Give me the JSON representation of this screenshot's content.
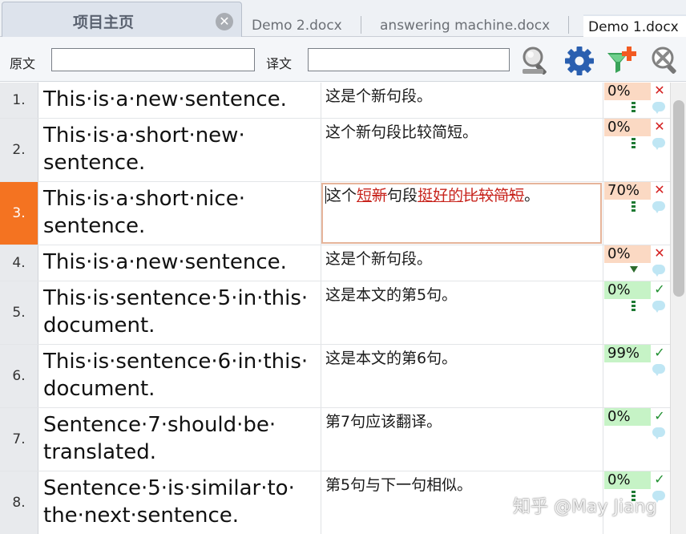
{
  "tabs": {
    "home_label": "项目主页",
    "close_glyph": "✕",
    "docs": [
      "Demo 2.docx",
      "answering machine.docx",
      "Demo 1.docx"
    ]
  },
  "filter": {
    "source_label": "原文",
    "source_value": "",
    "target_label": "译文",
    "target_value": ""
  },
  "toolbar_icons": [
    "search-icon",
    "gear-icon",
    "add-filter-icon",
    "clear-search-icon"
  ],
  "rows": [
    {
      "num": "1.",
      "source": "This·is·a·new·sentence.",
      "target": "这是个新句段。",
      "match": "0%"
    },
    {
      "num": "2.",
      "source": "This·is·a·short·new· sentence.",
      "target": "这个新句段比较简短。",
      "match": "0%"
    },
    {
      "num": "3.",
      "source": "This·is·a·short·nice· sentence.",
      "target_parts": [
        "这个",
        "短",
        "新",
        "句段",
        "挺好的",
        "比较简短",
        "。"
      ],
      "match": "70%"
    },
    {
      "num": "4.",
      "source": "This·is·a·new·sentence.",
      "target": "这是个新句段。",
      "match": "0%"
    },
    {
      "num": "5.",
      "source": "This·is·sentence·5·in·this· document.",
      "target": "这是本文的第5句。",
      "match": "0%"
    },
    {
      "num": "6.",
      "source": "This·is·sentence·6·in·this· document.",
      "target": "这是本文的第6句。",
      "match": "99%"
    },
    {
      "num": "7.",
      "source": "Sentence·7·should·be· translated.",
      "target": "第7句应该翻译。",
      "match": "0%"
    },
    {
      "num": "8.",
      "source": "Sentence·5·is·similar·to· the·next·sentence.",
      "target": "第5句与下一句相似。",
      "match": "0%"
    }
  ],
  "watermark": "知乎 @May Jiang",
  "colors": {
    "active_row": "#f47321",
    "match_warn": "#fbd9c3",
    "match_ok": "#c6f3c6",
    "tracked_change": "#c8241d",
    "status_error": "#d42020",
    "status_confirmed": "#1f8f2f"
  }
}
